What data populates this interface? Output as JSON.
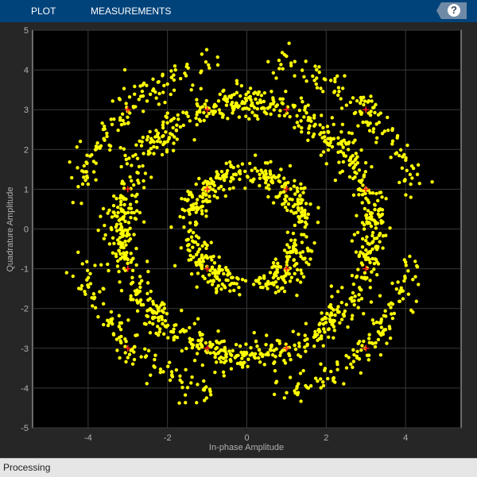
{
  "toolstrip": {
    "tabs": [
      "PLOT",
      "MEASUREMENTS"
    ],
    "help_label": "?"
  },
  "status": {
    "text": "Processing"
  },
  "colors": {
    "toolstrip": "#00437a",
    "points": "#ffff00",
    "reference": "#ff2020",
    "background": "#000000"
  },
  "chart_data": {
    "type": "scatter",
    "title": "",
    "xlabel": "In-phase Amplitude",
    "ylabel": "Quadrature Amplitude",
    "xlim": [
      -5.4,
      5.4
    ],
    "ylim": [
      -5,
      5
    ],
    "xticks": [
      -4,
      -2,
      0,
      2,
      4
    ],
    "yticks": [
      5,
      4,
      3,
      2,
      1,
      0,
      -1,
      -2,
      -3,
      -4,
      -5
    ],
    "grid": true,
    "reference_constellation": [
      [
        -3,
        3
      ],
      [
        -1,
        3
      ],
      [
        1,
        3
      ],
      [
        3,
        3
      ],
      [
        -3,
        1
      ],
      [
        -1,
        1
      ],
      [
        1,
        1
      ],
      [
        3,
        1
      ],
      [
        -3,
        -1
      ],
      [
        -1,
        -1
      ],
      [
        1,
        -1
      ],
      [
        3,
        -1
      ],
      [
        -3,
        -3
      ],
      [
        -1,
        -3
      ],
      [
        1,
        -3
      ],
      [
        3,
        -3
      ]
    ],
    "received_signal": {
      "description_rings_radius": [
        1.41,
        3.16,
        4.24
      ],
      "num_points": 2000,
      "noise_std": 0.2
    }
  }
}
